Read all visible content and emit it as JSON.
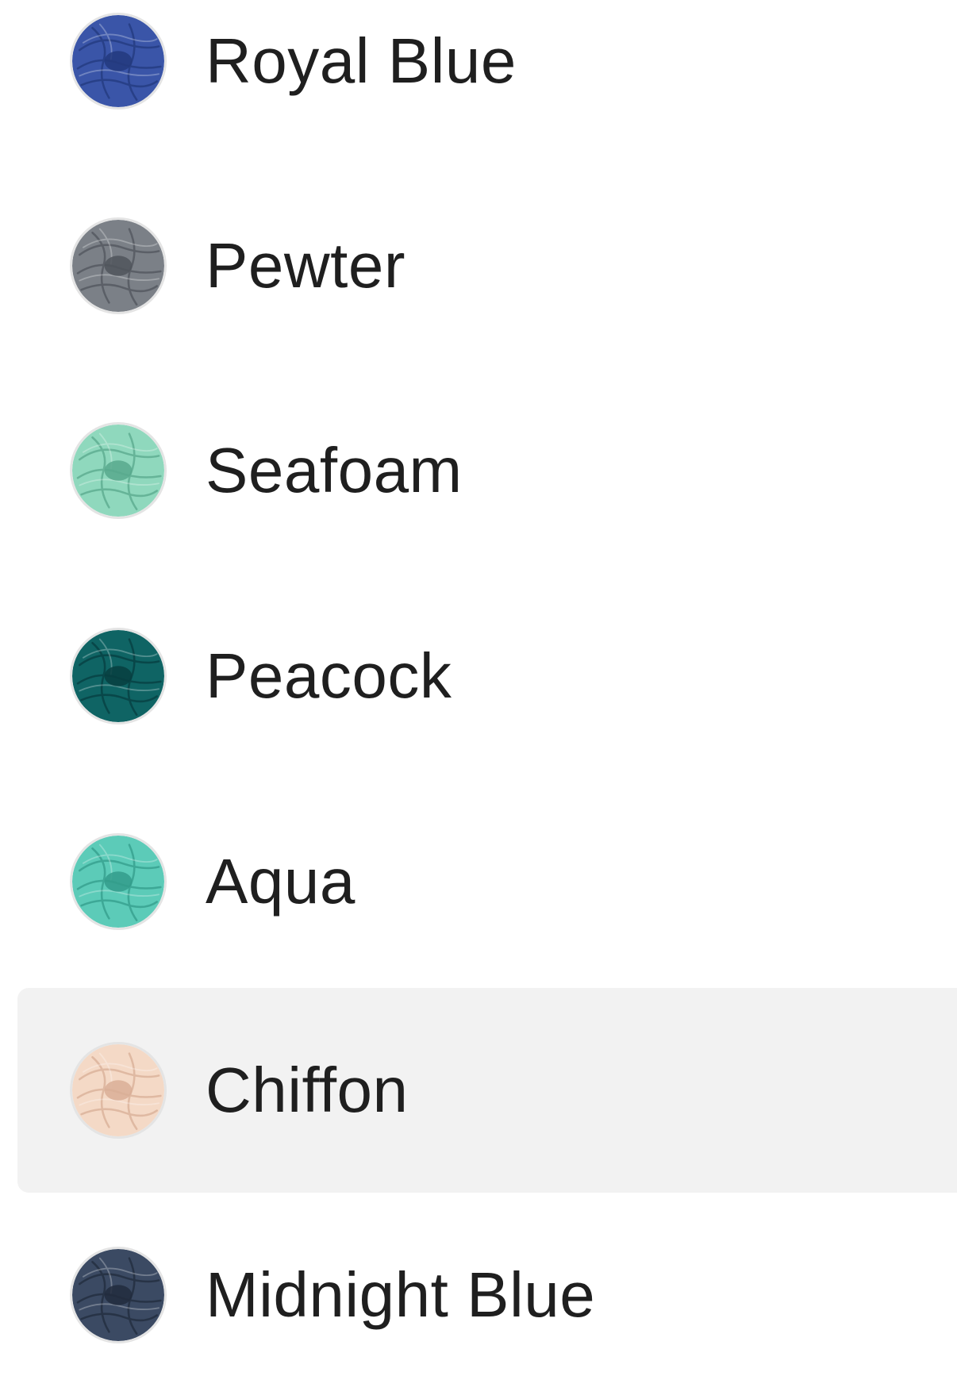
{
  "colors": [
    {
      "label": "Royal Blue",
      "swatch": "#3a55a8",
      "shade": "#233a7e",
      "icon": "yarn-ball-icon",
      "highlighted": false
    },
    {
      "label": "Pewter",
      "swatch": "#7b8087",
      "shade": "#50555c",
      "icon": "yarn-ball-icon",
      "highlighted": false
    },
    {
      "label": "Seafoam",
      "swatch": "#8fd8bd",
      "shade": "#58a98d",
      "icon": "yarn-ball-icon",
      "highlighted": false
    },
    {
      "label": "Peacock",
      "swatch": "#0f6464",
      "shade": "#073e40",
      "icon": "yarn-ball-icon",
      "highlighted": false
    },
    {
      "label": "Aqua",
      "swatch": "#5ccbb8",
      "shade": "#339c8b",
      "icon": "yarn-ball-icon",
      "highlighted": false
    },
    {
      "label": "Chiffon",
      "swatch": "#f4d9c6",
      "shade": "#d9ae96",
      "icon": "yarn-ball-icon",
      "highlighted": true
    },
    {
      "label": "Midnight Blue",
      "swatch": "#3b4a63",
      "shade": "#222c3d",
      "icon": "yarn-ball-icon",
      "highlighted": false
    }
  ]
}
